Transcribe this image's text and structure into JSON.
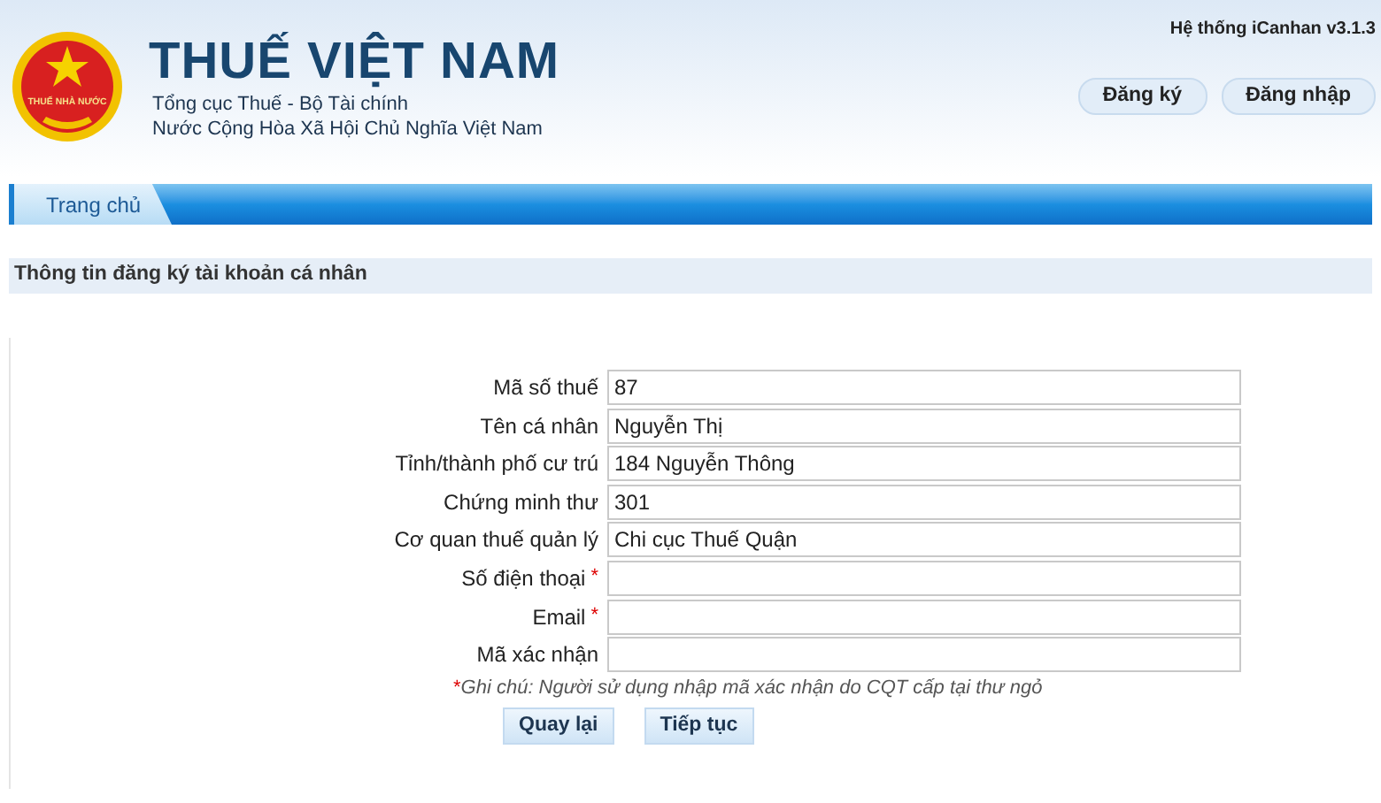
{
  "header": {
    "logo_text": "THUẾ NHÀ NƯỚC",
    "title": "THUẾ VIỆT NAM",
    "subtitle_lines": [
      "Tổng cục Thuế - Bộ Tài chính",
      "Nước Cộng Hòa Xã Hội Chủ Nghĩa Việt Nam"
    ],
    "system_version": "Hệ thống iCanhan v3.1.3",
    "buttons": [
      "Đăng ký",
      "Đăng nhập"
    ]
  },
  "nav": {
    "tabs": [
      {
        "label": "Trang chủ",
        "selected": true
      }
    ]
  },
  "section_title": "Thông tin đăng ký tài khoản cá nhân",
  "form": {
    "fields": [
      {
        "label": "Mã số thuế",
        "value": "87",
        "required": false
      },
      {
        "label": "Tên cá nhân",
        "value": "Nguyễn Thị",
        "required": false
      },
      {
        "label": "Tỉnh/thành phố cư trú",
        "value": "184 Nguyễn Thông",
        "required": false
      },
      {
        "label": "Chứng minh thư",
        "value": "301",
        "required": false
      },
      {
        "label": "Cơ quan thuế quản lý",
        "value": "Chi cục Thuế Quận",
        "required": false
      },
      {
        "label": "Số điện thoại",
        "required": true
      },
      {
        "label": "Email",
        "required": true
      },
      {
        "label": "Mã xác nhận",
        "required": false
      }
    ],
    "note_mark": "*",
    "note": "Ghi chú: Người sử dụng nhập mã xác nhận do CQT cấp tại thư ngỏ",
    "buttons": [
      "Quay lại",
      "Tiếp tục"
    ]
  }
}
